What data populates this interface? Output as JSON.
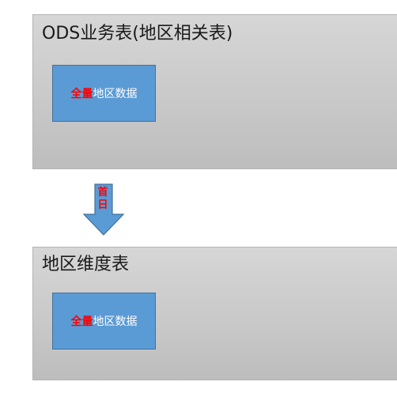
{
  "ods_panel": {
    "title": "ODS业务表(地区相关表)",
    "box": {
      "accent": "全量",
      "text": "地区数据"
    }
  },
  "arrow": {
    "label": "首日"
  },
  "dim_panel": {
    "title": "地区维度表",
    "box": {
      "accent": "全量",
      "text": "地区数据"
    }
  },
  "colors": {
    "panel_fill": "#cccccc",
    "box_fill": "#5b9bd5",
    "box_border": "#41719c",
    "accent": "#ff0000"
  }
}
